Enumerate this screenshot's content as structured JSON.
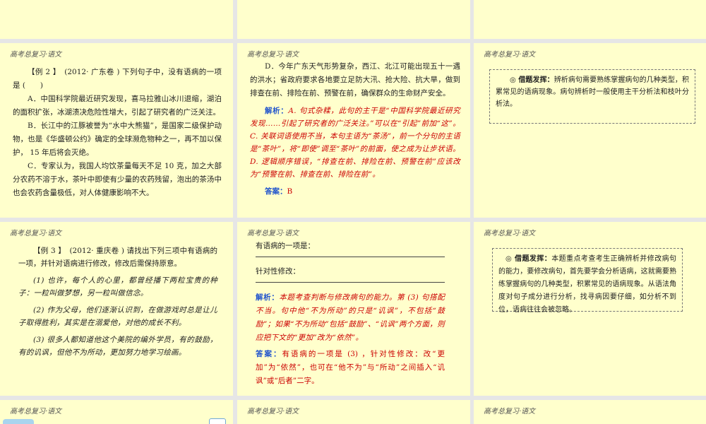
{
  "header": "高考总复习·语文",
  "slide4": {
    "q_head": "【例 2 】　(2012· 广东卷 ) 下列句子中，没有语病的一项是 (　　)",
    "a": "A．中国科学院最近研究发现，喜马拉雅山冰川退缩，湖泊的面积扩张，冰湖溃决危险性增大，引起了研究者的广泛关注。",
    "b": "B．长江中的江豚被誉为“水中大熊猫”，是国家二级保护动物，也是《华盛顿公约》确定的全球濒危物种之一，再不加以保护， 15 年后将会灭绝。",
    "c": "C．专家认为，我国人均饮茶量每天不足 10 克，加之大部分农药不溶于水，茶叶中即使有少量的农药残留，泡出的茶汤中也会农药含量极低，对人体健康影响不大。"
  },
  "slide5": {
    "d": "D．今年广东天气形势复杂，西江、北江可能出现五十一遇的洪水；省政府要求各地要立足防大汛、抢大险、抗大旱，做到排查在前、排险在前、预警在前，确保群众的生命财产安全。",
    "analysis_label": "解析：",
    "analysis": "A. 句式杂糅，此句的主干是“中国科学院最近研究发现……引起了研究者的广泛关注。”可以在“引起”前加“这”。 C. 关联词语使用不当，本句主语为“茶汤”，前一个分句的主语是“茶叶”，将“即使”调至“茶叶”的前面，使之成为让步状语。 D. 逻辑顺序错误，“排查在前、排险在前、预警在前”应该改为“预警在前、排查在前、排险在前”。",
    "answer_label": "答案：",
    "answer": "B"
  },
  "slide6": {
    "lead": "◎ 借题发挥：",
    "text": "辨析病句需要熟练掌握病句的几种类型，积累常见的语病现象。病句辨析时一般使用主干分析法和枝叶分析法。"
  },
  "slide7": {
    "q_head": "【例 3 】　(2012· 重庆卷 ) 请找出下列三项中有语病的一项，并针对语病进行修改，修改后需保持原意。",
    "s1": "(1) 也许，每个人的心里，都曾经播下两粒宝贵的种子：一粒叫做梦想，另一粒叫做信念。",
    "s2": "(2) 作为父母，他们逐渐认识到，在做游戏时总是让儿子取得胜利，其实是在溺爱他，对他的成长不利。",
    "s3": "(3) 很多人都知道他这个美院的编外学员，有的鼓励，有的讥讽，但他不为所动，更加努力地学习绘画。"
  },
  "slide8": {
    "q1": "有语病的一项是：",
    "q2": "针对性修改：",
    "analysis_label": "解析：",
    "analysis": "本题考查判断与修改病句的能力。第 (3) 句搭配不当。句中他“不为所动”的只是“讥讽”，不包括“鼓励”；如果“不为所动”包括“鼓励”、“讥讽”两个方面，则应把下文的“更加”改为“依然”。",
    "answer_label": "答案：",
    "answer": "有语病的一项是 (3) ，针对性修改：改“更加”为“依然”，也可在“他不为”与“所动”之间插入“讥讽”或“后者”二字。"
  },
  "slide9": {
    "lead": "◎ 借题发挥：",
    "text": "本题重点考查考生正确辨析并修改病句的能力，要修改病句，首先要学会分析语病，这就需要熟练掌握病句的几种类型，积累常见的语病现象。从语法角度对句子成分进行分析，找寻病因要仔细，如分析不到位，语病往往会被忽略。"
  }
}
